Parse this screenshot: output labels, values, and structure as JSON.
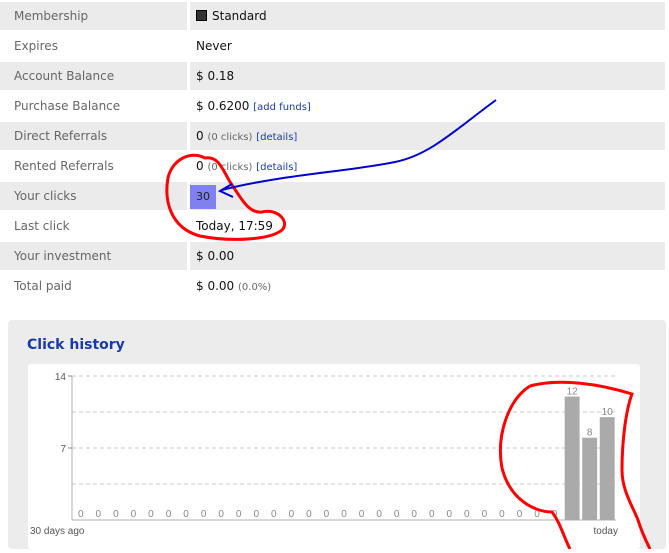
{
  "stats": [
    {
      "label": "Membership",
      "value": "Standard"
    },
    {
      "label": "Expires",
      "value": "Never"
    },
    {
      "label": "Account Balance",
      "value": "$ 0.18"
    },
    {
      "label": "Purchase Balance",
      "value": "$ 0.6200",
      "link": "[add funds]"
    },
    {
      "label": "Direct Referrals",
      "value": "0",
      "note": "(0 clicks)",
      "link": "[details]"
    },
    {
      "label": "Rented Referrals",
      "value": "0",
      "note": "(0 clicks)",
      "link": "[details]"
    },
    {
      "label": "Your clicks",
      "value": "30"
    },
    {
      "label": "Last click",
      "value": "Today, 17:59"
    },
    {
      "label": "Your investment",
      "value": "$ 0.00"
    },
    {
      "label": "Total paid",
      "value": "$ 0.00",
      "note": "(0.0%)"
    }
  ],
  "membership_icon": "square-icon",
  "highlight_color": "#8080f0",
  "annotation_colors": {
    "circle": "#ff0000",
    "arrow": "#0000cc"
  },
  "click_history": {
    "title": "Click history",
    "chart_data": {
      "type": "bar",
      "ylim": [
        0,
        14
      ],
      "y_ticks": [
        7,
        14
      ],
      "x_label_left": "30 days ago",
      "x_label_right": "today",
      "values": [
        0,
        0,
        0,
        0,
        0,
        0,
        0,
        0,
        0,
        0,
        0,
        0,
        0,
        0,
        0,
        0,
        0,
        0,
        0,
        0,
        0,
        0,
        0,
        0,
        0,
        0,
        0,
        0,
        12,
        8,
        10
      ],
      "grid": "dashed",
      "bar_color": "#aaaaaa"
    }
  }
}
